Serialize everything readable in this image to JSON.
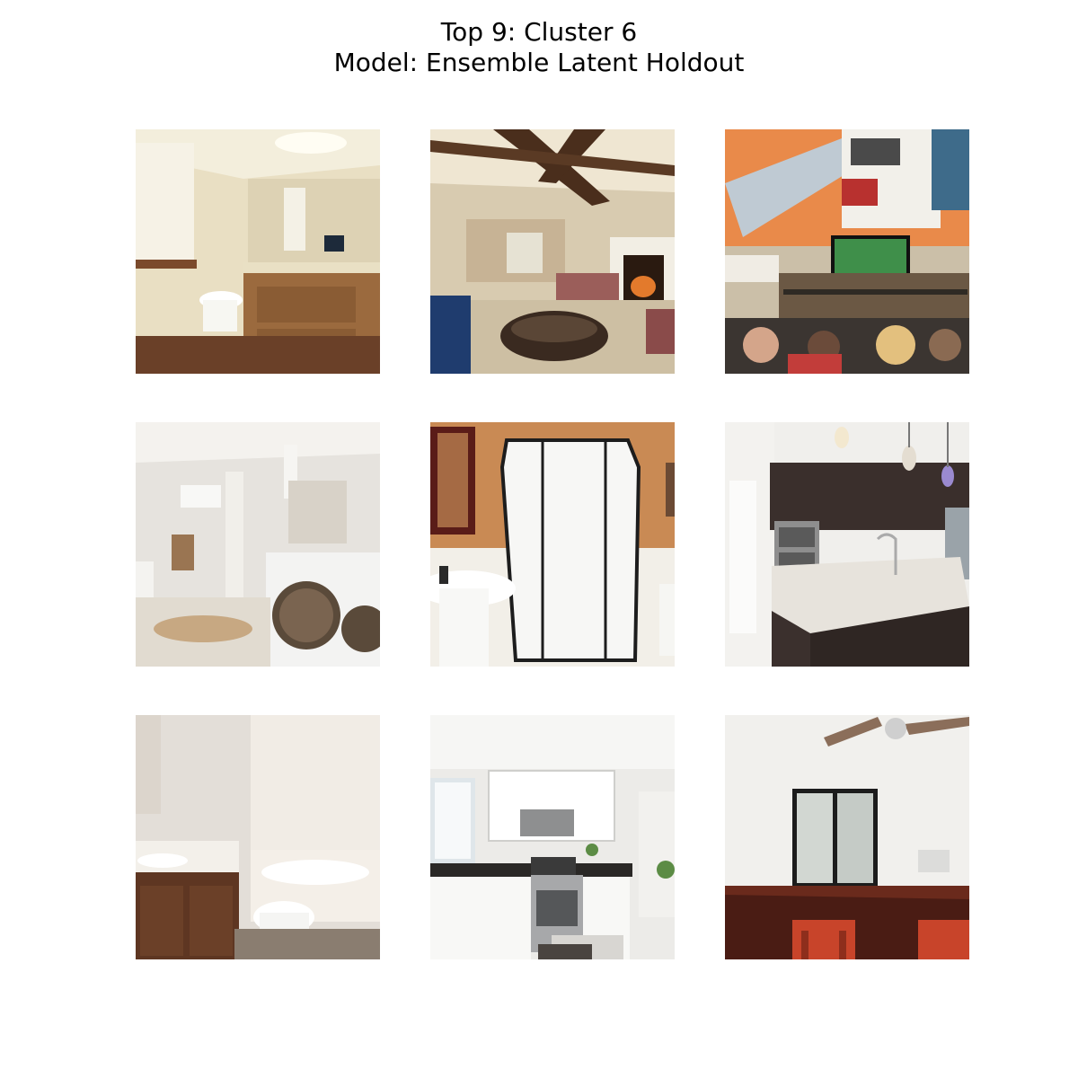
{
  "figure": {
    "title_line1": "Top 9: Cluster 6",
    "title_line2": "Model: Ensemble Latent Holdout"
  },
  "tiles": [
    {
      "subject": "bathroom-vanity-photo"
    },
    {
      "subject": "living-room-fireplace-photo"
    },
    {
      "subject": "bar-mural-crowd-photo"
    },
    {
      "subject": "bathroom-laundry-photo"
    },
    {
      "subject": "bathroom-shower-photo"
    },
    {
      "subject": "kitchen-island-photo"
    },
    {
      "subject": "bathroom-tub-photo"
    },
    {
      "subject": "white-kitchen-photo"
    },
    {
      "subject": "dining-room-photo"
    }
  ]
}
